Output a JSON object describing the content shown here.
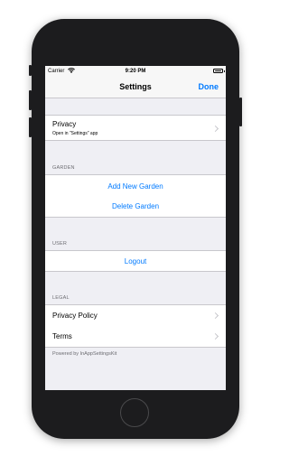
{
  "status_bar": {
    "carrier": "Carrier",
    "time": "9:20 PM",
    "wifi_icon": "wifi-icon",
    "battery_icon": "battery-icon"
  },
  "nav": {
    "title": "Settings",
    "done_label": "Done"
  },
  "privacy": {
    "title": "Privacy",
    "subtitle": "Open in \"Settings\" app"
  },
  "garden": {
    "header": "GARDEN",
    "add_label": "Add New Garden",
    "delete_label": "Delete Garden"
  },
  "user": {
    "header": "USER",
    "logout_label": "Logout"
  },
  "legal": {
    "header": "LEGAL",
    "privacy_policy_label": "Privacy Policy",
    "terms_label": "Terms"
  },
  "footer": "Powered by InAppSettingsKit",
  "colors": {
    "accent": "#007aff",
    "background": "#efeff4",
    "phone_body": "#1c1c1e"
  }
}
